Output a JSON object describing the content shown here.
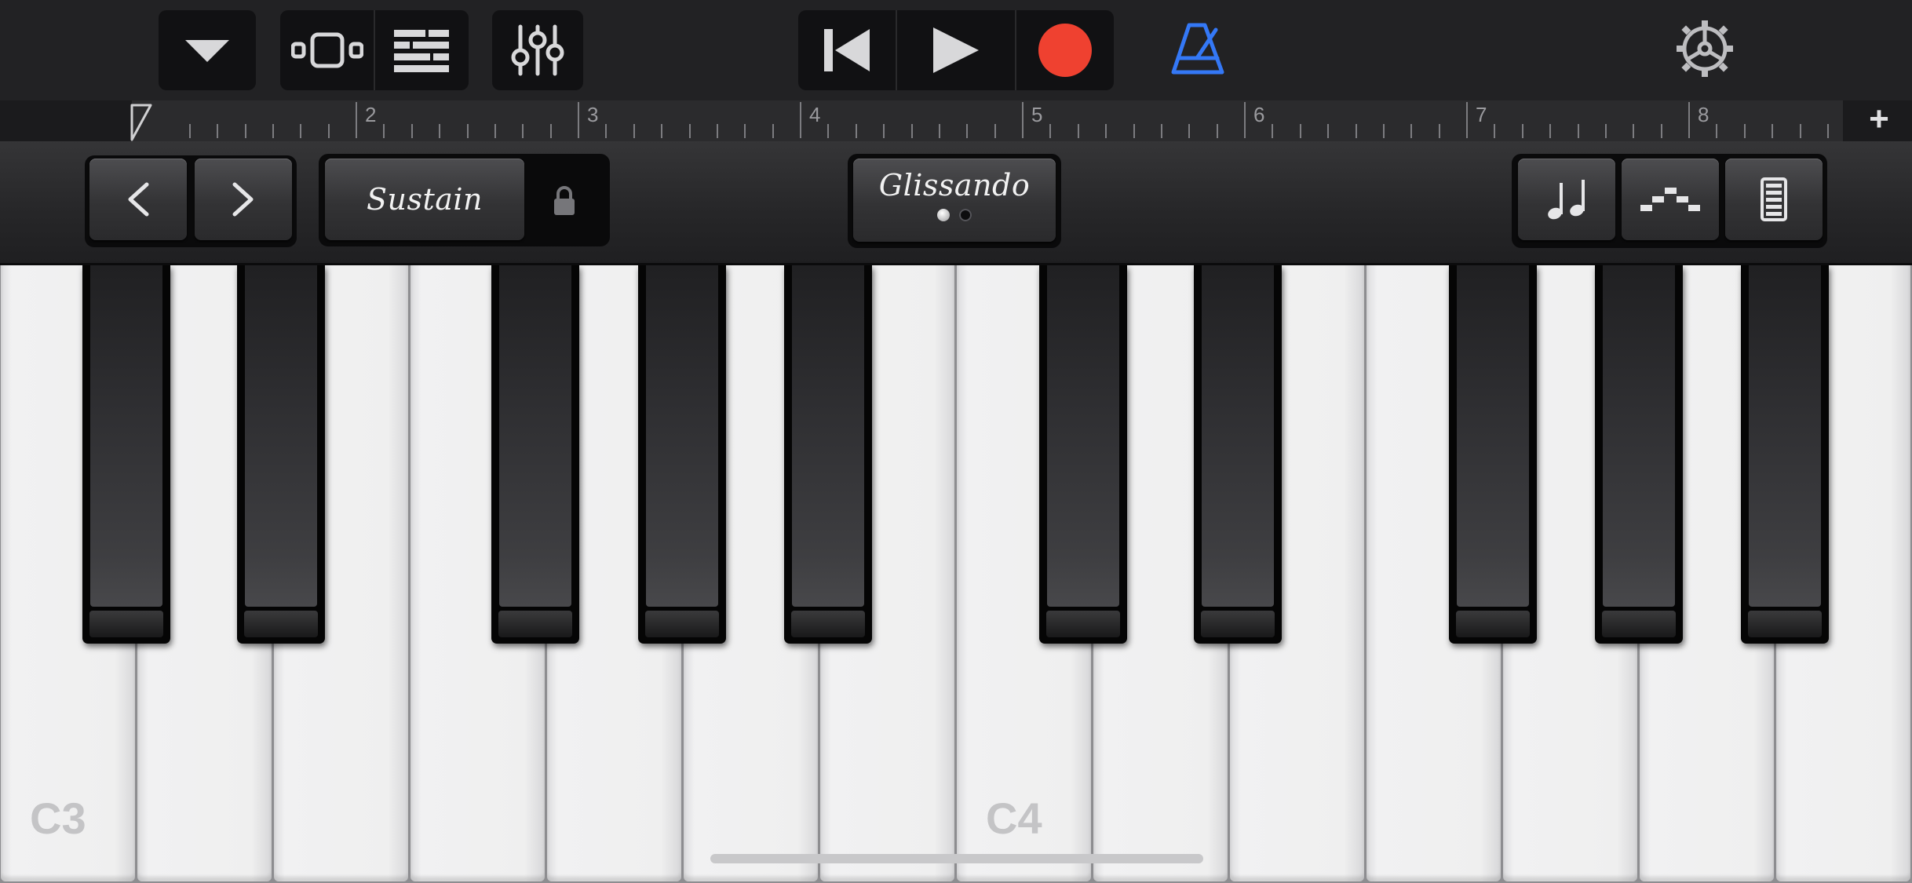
{
  "transport": {
    "record_color": "#ef4130",
    "metronome_color": "#3478f6"
  },
  "ruler": {
    "bars": [
      "2",
      "3",
      "4",
      "5",
      "6",
      "7",
      "8"
    ],
    "add_label": "+"
  },
  "controls": {
    "sustain_label": "Sustain",
    "glissando_label": "Glissando",
    "glissando_page": 1,
    "glissando_pages": 2
  },
  "keyboard": {
    "labels": [
      "C3",
      "C4"
    ]
  },
  "icons": [
    "dropdown-arrow-icon",
    "tracks-view-icon",
    "browser-icon",
    "mixer-icon",
    "go-to-beginning-icon",
    "play-icon",
    "record-icon",
    "metronome-icon",
    "settings-gear-icon",
    "octave-down-icon",
    "octave-up-icon",
    "lock-icon",
    "notes-icon",
    "arpeggiator-icon",
    "velocity-icon"
  ]
}
